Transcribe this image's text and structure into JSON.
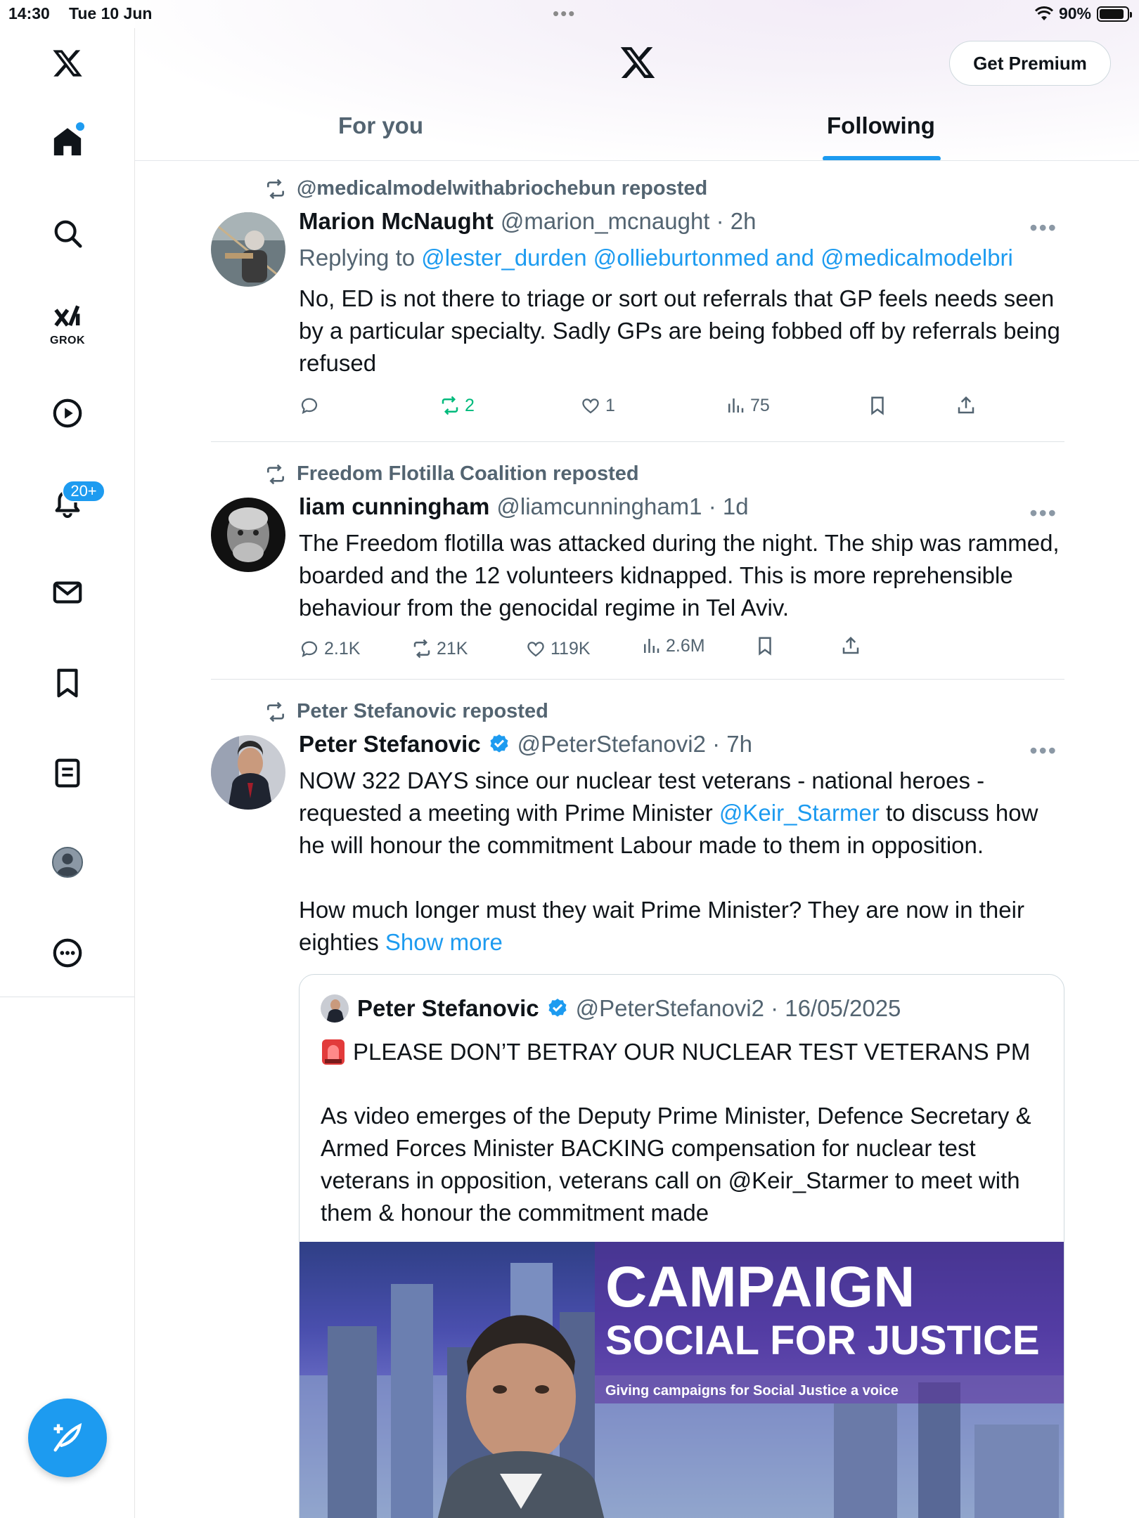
{
  "status_bar": {
    "time": "14:30",
    "date": "Tue 10 Jun",
    "battery": "90%",
    "battery_level": 0.9
  },
  "header": {
    "premium_label": "Get Premium",
    "tabs": [
      {
        "label": "For you",
        "active": false
      },
      {
        "label": "Following",
        "active": true
      }
    ]
  },
  "sidebar": {
    "grok_label": "GROK",
    "notifications_badge": "20+"
  },
  "colors": {
    "accent": "#1d9bf0",
    "text": "#0f1419",
    "muted": "#536471",
    "repost_green": "#00ba7c"
  },
  "posts": [
    {
      "repost_by": "@medicalmodelwithabriochebun reposted",
      "name": "Marion McNaught",
      "handle_time": "@marion_mcnaught · 2h",
      "replying_prefix": "Replying to",
      "replying_links": "@lester_durden @ollieburtonmed and @medicalmodelbri",
      "text": "No, ED is not there to triage or sort out referrals that GP feels needs seen by a particular specialty. Sadly GPs are being fobbed off by referrals being refused",
      "replies": "",
      "reposts": "2",
      "likes": "1",
      "views": "75"
    },
    {
      "repost_by": "Freedom Flotilla Coalition reposted",
      "name": "liam cunningham",
      "handle_time": "@liamcunningham1 · 1d",
      "text": "The Freedom flotilla was attacked during the night. The ship was rammed, boarded and the 12 volunteers kidnapped. This is more reprehensible behaviour from the genocidal regime in Tel Aviv.",
      "replies": "2.1K",
      "reposts": "21K",
      "likes": "119K",
      "views": "2.6M"
    },
    {
      "repost_by": "Peter Stefanovic reposted",
      "name": "Peter Stefanovic",
      "handle_time": "@PeterStefanovi2 · 7h",
      "text_part1": "NOW 322 DAYS since our nuclear test veterans - national heroes - requested a meeting with Prime Minister",
      "text_mention": "@Keir_Starmer",
      "text_part2": "to discuss how he will honour the commitment Labour made to them in opposition.",
      "text_para2": "How much longer must they wait Prime Minister? They are now in their eighties",
      "show_more": "Show more",
      "quote": {
        "name": "Peter Stefanovic",
        "handle_time": "@PeterStefanovi2 · 16/05/2025",
        "title": "PLEASE DON’T BETRAY OUR NUCLEAR TEST VETERANS PM",
        "body": "As video emerges of the Deputy Prime Minister, Defence Secretary & Armed Forces Minister BACKING compensation for nuclear test veterans in opposition, veterans call on @Keir_Starmer to meet with them & honour the commitment made",
        "image_text": {
          "line1": "CAMPAIGN",
          "line2": "SOCIAL FOR JUSTICE",
          "tagline": "Giving campaigns for Social Justice a voice"
        }
      }
    }
  ]
}
